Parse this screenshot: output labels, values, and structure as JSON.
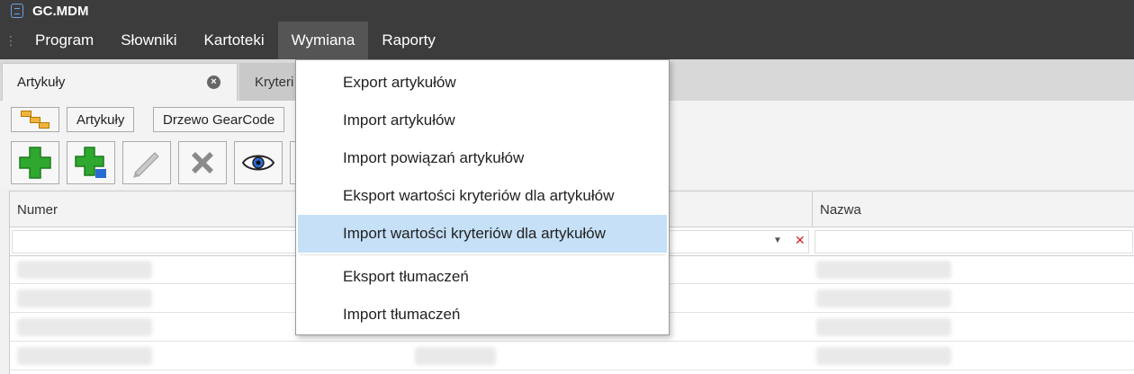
{
  "app": {
    "title": "GC.MDM",
    "icon": "database-icon"
  },
  "menubar": {
    "grip_icon": "grip-dots-icon",
    "items": [
      {
        "label": "Program",
        "active": false
      },
      {
        "label": "Słowniki",
        "active": false
      },
      {
        "label": "Kartoteki",
        "active": false
      },
      {
        "label": "Wymiana",
        "active": true
      },
      {
        "label": "Raporty",
        "active": false
      }
    ]
  },
  "tabs": [
    {
      "label": "Artykuły",
      "active": true,
      "close_icon": "close-circle-icon"
    },
    {
      "label": "Kryteri",
      "active": false
    }
  ],
  "crumbs": {
    "tree_icon": "tree-structure-icon",
    "items": [
      {
        "label": "Artykuły"
      },
      {
        "label": "Drzewo GearCode"
      }
    ]
  },
  "toolbar": {
    "buttons": [
      {
        "icon": "add-icon"
      },
      {
        "icon": "add-multiple-icon"
      },
      {
        "icon": "edit-pencil-icon"
      },
      {
        "icon": "delete-x-icon"
      },
      {
        "icon": "view-eye-icon"
      }
    ]
  },
  "grid": {
    "columns": [
      {
        "label": "Numer"
      },
      {
        "label": ""
      },
      {
        "label": "Nazwa"
      }
    ],
    "filter_icons": {
      "dropdown": "dropdown-arrow-icon",
      "clear": "clear-filter-icon"
    }
  },
  "dropdown": {
    "items": [
      {
        "label": "Export artykułów",
        "highlighted": false
      },
      {
        "label": "Import artykułów",
        "highlighted": false
      },
      {
        "label": "Import powiązań artykułów",
        "highlighted": false
      },
      {
        "label": "Eksport wartości kryteriów dla artykułów",
        "highlighted": false
      },
      {
        "label": "Import wartości kryteriów dla artykułów",
        "highlighted": true
      },
      {
        "label": "Eksport tłumaczeń",
        "highlighted": false
      },
      {
        "label": "Import tłumaczeń",
        "highlighted": false
      }
    ]
  },
  "colors": {
    "titlebar": "#3c3c3c",
    "highlight": "#c5e0f7",
    "accent_green": "#2ea82e",
    "clear_red": "#d22222"
  }
}
